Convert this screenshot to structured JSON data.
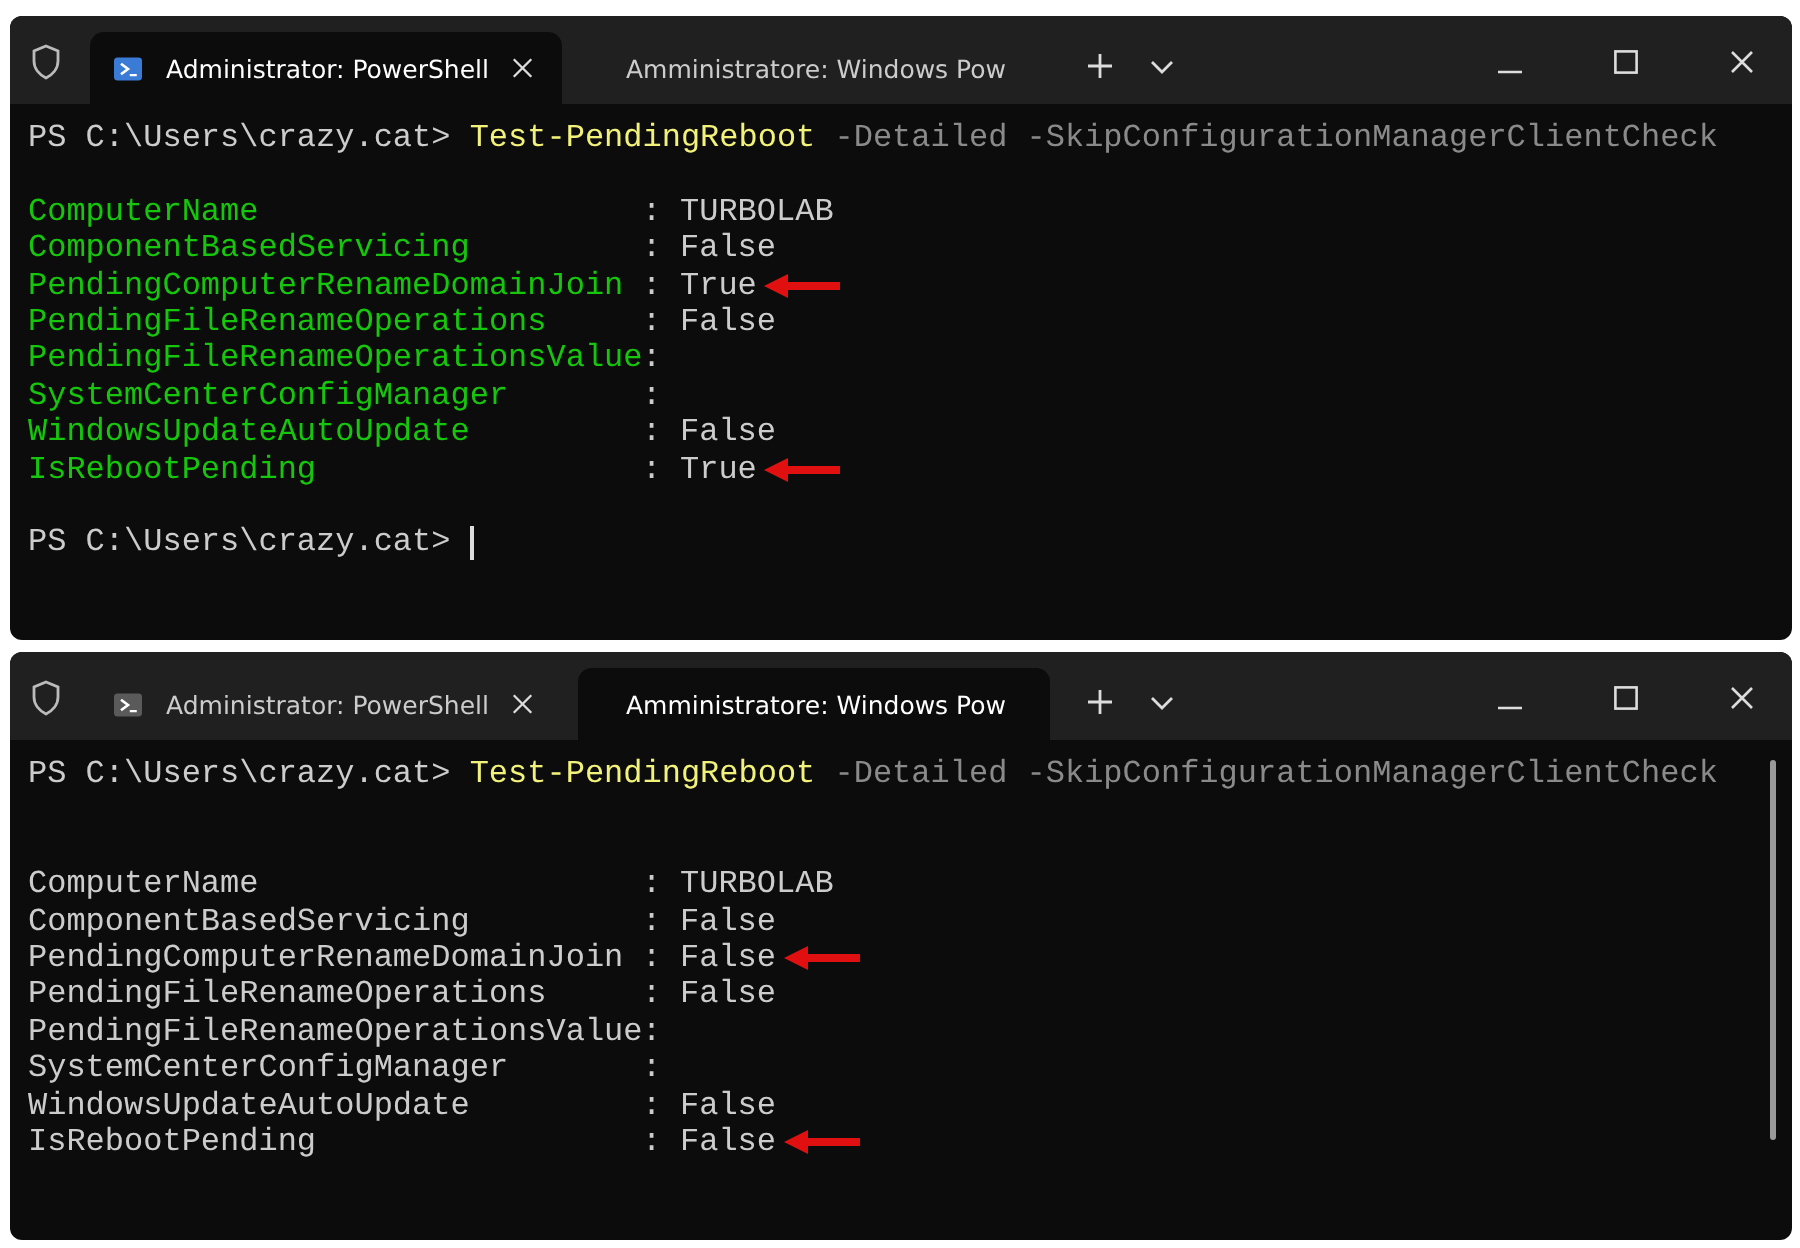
{
  "windows": [
    {
      "tabs": [
        {
          "title": "Administrator: PowerShell",
          "selected": true
        },
        {
          "title": "Amministratore: Windows Pow",
          "selected": false
        }
      ],
      "command": {
        "prompt": "PS C:\\Users\\crazy.cat>",
        "cmdlet": "Test-PendingReboot",
        "parameters": "-Detailed -SkipConfigurationManagerClientCheck"
      },
      "extra_blank_line": false,
      "colored_names": true,
      "rows": [
        {
          "name": "ComputerName",
          "separator": ":",
          "value": "TURBOLAB",
          "marked": false
        },
        {
          "name": "ComponentBasedServicing",
          "separator": ":",
          "value": "False",
          "marked": false
        },
        {
          "name": "PendingComputerRenameDomainJoin",
          "separator": ":",
          "value": "True",
          "marked": true
        },
        {
          "name": "PendingFileRenameOperations",
          "separator": ":",
          "value": "False",
          "marked": false
        },
        {
          "name": "PendingFileRenameOperationsValue",
          "separator": ":",
          "value": "",
          "marked": false
        },
        {
          "name": "SystemCenterConfigManager",
          "separator": ":",
          "value": "",
          "marked": false
        },
        {
          "name": "WindowsUpdateAutoUpdate",
          "separator": ":",
          "value": "False",
          "marked": false
        },
        {
          "name": "IsRebootPending",
          "separator": ":",
          "value": "True",
          "marked": true
        }
      ],
      "final_prompt": "PS C:\\Users\\crazy.cat>",
      "cursor": true
    },
    {
      "tabs": [
        {
          "title": "Administrator: PowerShell",
          "selected": false
        },
        {
          "title": "Amministratore: Windows Pow",
          "selected": true
        }
      ],
      "command": {
        "prompt": "PS C:\\Users\\crazy.cat>",
        "cmdlet": "Test-PendingReboot",
        "parameters": "-Detailed -SkipConfigurationManagerClientCheck"
      },
      "extra_blank_line": true,
      "colored_names": false,
      "rows": [
        {
          "name": "ComputerName",
          "separator": ":",
          "value": "TURBOLAB",
          "marked": false
        },
        {
          "name": "ComponentBasedServicing",
          "separator": ":",
          "value": "False",
          "marked": false
        },
        {
          "name": "PendingComputerRenameDomainJoin",
          "separator": ":",
          "value": "False",
          "marked": true
        },
        {
          "name": "PendingFileRenameOperations",
          "separator": ":",
          "value": "False",
          "marked": false
        },
        {
          "name": "PendingFileRenameOperationsValue",
          "separator": ":",
          "value": "",
          "marked": false
        },
        {
          "name": "SystemCenterConfigManager",
          "separator": ":",
          "value": "",
          "marked": false
        },
        {
          "name": "WindowsUpdateAutoUpdate",
          "separator": ":",
          "value": "False",
          "marked": false
        },
        {
          "name": "IsRebootPending",
          "separator": ":",
          "value": "False",
          "marked": true
        }
      ],
      "scrollbar_visible": true
    }
  ]
}
